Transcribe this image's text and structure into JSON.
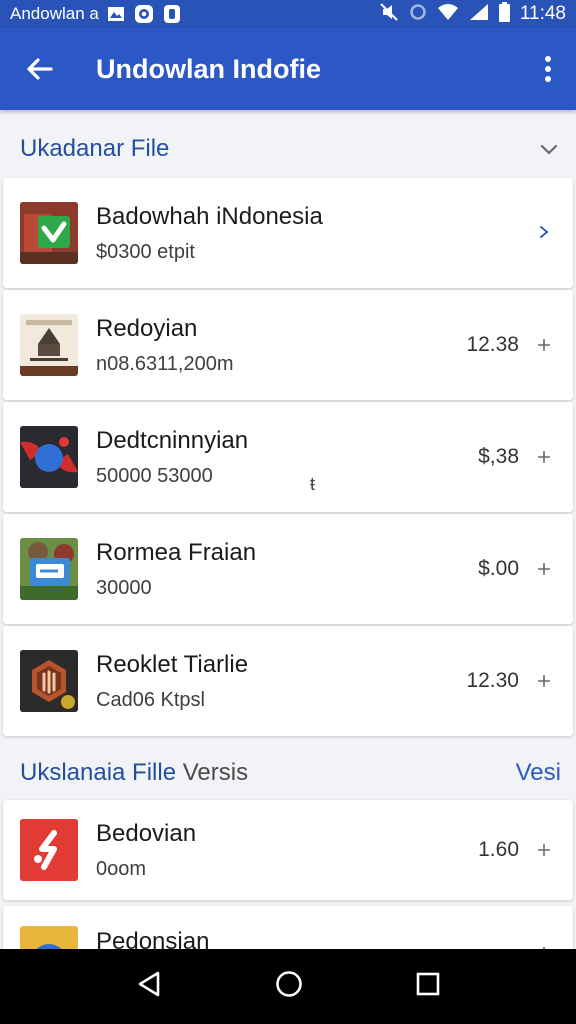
{
  "status_bar": {
    "carrier": "Andowlan",
    "carrier_suffix": "a",
    "time": "11:48"
  },
  "app_bar": {
    "title": "Undowlan Indofie"
  },
  "section1": {
    "title": "Ukadanar File"
  },
  "section1_items": [
    {
      "name": "Badowhah iNdonesia",
      "sub": "$0300 etpit",
      "value": "",
      "icon": "green-shield-icon"
    },
    {
      "name": "Redoyian",
      "sub": "n08.6311,200m",
      "value": "12.38",
      "icon": "document-cover-icon"
    },
    {
      "name": "Dedtcninnyian",
      "sub": "50000 53000",
      "value": "$,38",
      "icon": "blue-ball-icon",
      "mark": "ŧ"
    },
    {
      "name": "Rormea Fraian",
      "sub": "30000",
      "value": "$.00",
      "icon": "photo-collage-icon"
    },
    {
      "name": "Reoklet Tiarlie",
      "sub": "Cad06 Ktpsl",
      "value": "12.30",
      "icon": "hexagon-badge-icon"
    }
  ],
  "section2": {
    "title_main": "Ukslanaia Fille",
    "title_muted": " Versis",
    "action": "Vesi"
  },
  "section2_items": [
    {
      "name": "Bedovian",
      "sub": "0oom",
      "value": "1.60",
      "icon": "red-app-icon"
    },
    {
      "name": "Pedonsian",
      "sub": "",
      "value": "",
      "icon": "blue-yellow-app-icon"
    }
  ],
  "colors": {
    "app_bar": "#2c58c6",
    "status_bar": "#2a53b8",
    "section_title": "#244f9e",
    "background": "#f1f3f6"
  }
}
